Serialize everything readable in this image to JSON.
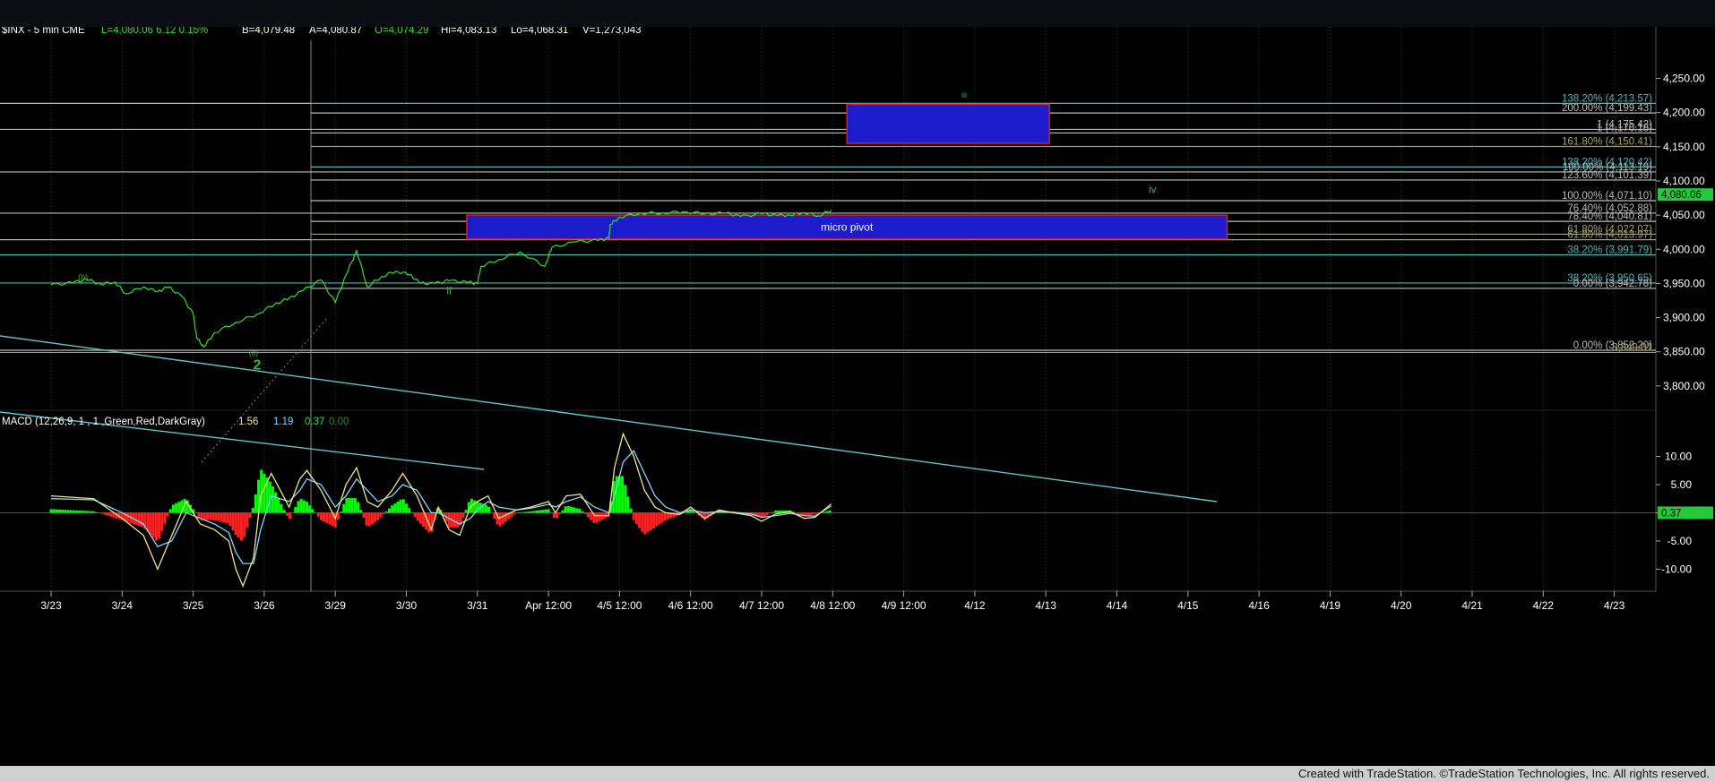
{
  "header": {
    "symbol_label": "$INX - 5 min  CME",
    "quote_last": "L=4,080.06  6.12   0.15%",
    "quote_bid": "B=4,079.48",
    "quote_ask": "A=4,080.87",
    "quote_open": "O=4,074.29",
    "quote_high": "Hi=4,083.13",
    "quote_low": "Lo=4,068.31",
    "quote_volume": "V=1,273,043"
  },
  "macd_header": {
    "label": "MACD (12,26,9, 1 , 1 ,Green,Red,DarkGray)",
    "v1": "1.56",
    "v2": "1.19",
    "v3": "0.37",
    "v4": "0.00"
  },
  "footer_text": "Created with TradeStation. ©TradeStation Technologies, Inc. All rights reserved.",
  "colors": {
    "price": "#33dd33",
    "macd_line": "#f0e68c",
    "signal_line": "#7fd8ff",
    "hist_pos": "#00ff00",
    "hist_neg": "#ff2020",
    "trendline": "#5fc6c8",
    "box_fill": "#1c1ccc",
    "box_border": "#cc1f33",
    "last_price_bg": "#22c93a"
  },
  "chart_data": [
    {
      "type": "line",
      "title": "$INX - 5 min",
      "y_axis_ticks": [
        "4,250.00",
        "4,200.00",
        "4,150.00",
        "4,100.00",
        "4,050.00",
        "4,000.00",
        "3,950.00",
        "3,900.00",
        "3,850.00",
        "3,800.00"
      ],
      "ylim": [
        3788,
        4273
      ],
      "x_ticks": [
        "3/23",
        "3/24",
        "3/25",
        "3/26",
        "3/29",
        "3/30",
        "3/31",
        "Apr 12:00",
        "4/5 12:00",
        "4/6 12:00",
        "4/7 12:00",
        "4/8 12:00",
        "4/9 12:00",
        "4/12",
        "4/13",
        "4/14",
        "4/15",
        "4/16",
        "4/19",
        "4/20",
        "4/21",
        "4/22",
        "4/23"
      ],
      "last_price_label": "4,080.06",
      "price_series": [
        [
          0.0,
          3948
        ],
        [
          0.3,
          3951
        ],
        [
          0.5,
          3956
        ],
        [
          0.7,
          3949
        ],
        [
          0.9,
          3952
        ],
        [
          1.05,
          3935
        ],
        [
          1.3,
          3945
        ],
        [
          1.5,
          3938
        ],
        [
          1.65,
          3945
        ],
        [
          1.85,
          3930
        ],
        [
          2.0,
          3905
        ],
        [
          2.05,
          3870
        ],
        [
          2.15,
          3857
        ],
        [
          2.3,
          3878
        ],
        [
          2.6,
          3893
        ],
        [
          2.9,
          3905
        ],
        [
          3.15,
          3920
        ],
        [
          3.35,
          3928
        ],
        [
          3.55,
          3940
        ],
        [
          3.8,
          3955
        ],
        [
          4.0,
          3922
        ],
        [
          4.15,
          3962
        ],
        [
          4.3,
          3998
        ],
        [
          4.45,
          3945
        ],
        [
          4.65,
          3960
        ],
        [
          4.85,
          3968
        ],
        [
          5.05,
          3963
        ],
        [
          5.2,
          3950
        ],
        [
          5.4,
          3950
        ],
        [
          5.6,
          3954
        ],
        [
          5.85,
          3952
        ],
        [
          6.0,
          3950
        ],
        [
          6.05,
          3975
        ],
        [
          6.3,
          3985
        ],
        [
          6.6,
          3996
        ],
        [
          6.95,
          3975
        ],
        [
          7.05,
          4003
        ],
        [
          7.4,
          4011
        ],
        [
          7.7,
          4013
        ],
        [
          7.85,
          4016
        ],
        [
          7.87,
          4036
        ],
        [
          8.0,
          4047
        ],
        [
          8.3,
          4053
        ],
        [
          8.6,
          4053
        ],
        [
          8.9,
          4055
        ],
        [
          9.2,
          4052
        ],
        [
          9.5,
          4053
        ],
        [
          9.7,
          4048
        ],
        [
          10.0,
          4052
        ],
        [
          10.2,
          4050
        ],
        [
          10.4,
          4050
        ],
        [
          10.6,
          4054
        ],
        [
          10.8,
          4049
        ],
        [
          10.98,
          4057
        ]
      ],
      "fib_lines": [
        {
          "label": "138.20% (4,213.57)",
          "y": 4213.57
        },
        {
          "label": "200.00% (4,199.43)",
          "y": 4199.43
        },
        {
          "label": "1 (4,175.42)",
          "y": 4175.42
        },
        {
          "label": "1 (4,170.18)",
          "y": 4170.18
        },
        {
          "label": "161.80% (4,150.41)",
          "y": 4150.41
        },
        {
          "label": "138.20% (4,120.42)",
          "y": 4120.42
        },
        {
          "label": "100.00% (4,113.19)",
          "y": 4113.19
        },
        {
          "label": "123.60% (4,101.39)",
          "y": 4101.39
        },
        {
          "label": "100.00% (4,071.10)",
          "y": 4071.1
        },
        {
          "label": "76.40% (4,052.88)",
          "y": 4052.88
        },
        {
          "label": "78.40% (4,040.81)",
          "y": 4040.81
        },
        {
          "label": "61.80% (4,022.07)",
          "y": 4022.07
        },
        {
          "label": "61.80% (4,013.97)",
          "y": 4013.97
        },
        {
          "label": "38.20% (3,991.79)",
          "y": 3991.79
        },
        {
          "label": "38.20% (3,950.65)",
          "y": 3950.65
        },
        {
          "label": "0.00% (3,942.78)",
          "y": 3942.78
        },
        {
          "label": "0.00% (3,852.20)",
          "y": 3852.2
        },
        {
          "label": "3,849.01",
          "y": 3849.01
        }
      ],
      "boxes": [
        {
          "label": "",
          "x0": 11.2,
          "x1": 14.05,
          "y0": 4155,
          "y1": 4212
        },
        {
          "label": "micro pivot",
          "x0": 5.85,
          "x1": 16.55,
          "y0": 4015,
          "y1": 4050
        }
      ],
      "wave_labels": [
        {
          "text": "(b)",
          "x": 0.45,
          "y": 3955
        },
        {
          "text": "(c)",
          "x": 2.85,
          "y": 3845
        },
        {
          "text": "2",
          "x": 2.9,
          "y": 3824
        },
        {
          "text": "ii",
          "x": 5.6,
          "y": 3934
        },
        {
          "text": "iii",
          "x": 12.85,
          "y": 4222
        },
        {
          "text": "iv",
          "x": 15.5,
          "y": 4082
        }
      ]
    },
    {
      "type": "line",
      "title": "MACD (12,26,9, 1 , 1 ,Green,Red,DarkGray)",
      "y_axis_ticks": [
        "10.00",
        "5.00",
        "",
        "-5.00",
        "-10.00"
      ],
      "ylim": [
        -12,
        15
      ],
      "last_value_label": "0.37",
      "macd_series": [
        [
          0,
          3
        ],
        [
          0.6,
          2.5
        ],
        [
          1.0,
          -1
        ],
        [
          1.3,
          -4
        ],
        [
          1.5,
          -10
        ],
        [
          1.7,
          -4
        ],
        [
          1.9,
          2
        ],
        [
          2.1,
          -2
        ],
        [
          2.3,
          -3
        ],
        [
          2.5,
          -5
        ],
        [
          2.6,
          -10
        ],
        [
          2.7,
          -13
        ],
        [
          2.85,
          -8
        ],
        [
          2.95,
          3
        ],
        [
          3.1,
          7
        ],
        [
          3.35,
          1
        ],
        [
          3.5,
          6
        ],
        [
          3.6,
          7.5
        ],
        [
          3.8,
          4
        ],
        [
          4.0,
          -1
        ],
        [
          4.15,
          5
        ],
        [
          4.3,
          8
        ],
        [
          4.45,
          2
        ],
        [
          4.6,
          1
        ],
        [
          4.8,
          4
        ],
        [
          4.95,
          7
        ],
        [
          5.15,
          3
        ],
        [
          5.35,
          -3
        ],
        [
          5.45,
          1
        ],
        [
          5.6,
          -3
        ],
        [
          5.75,
          -4
        ],
        [
          5.9,
          1
        ],
        [
          6.0,
          2
        ],
        [
          6.15,
          3
        ],
        [
          6.3,
          -1
        ],
        [
          6.55,
          0.5
        ],
        [
          6.75,
          1
        ],
        [
          7.0,
          2
        ],
        [
          7.1,
          0
        ],
        [
          7.25,
          3
        ],
        [
          7.45,
          3.3
        ],
        [
          7.65,
          -0.5
        ],
        [
          7.85,
          -0.5
        ],
        [
          7.93,
          8
        ],
        [
          8.05,
          14
        ],
        [
          8.2,
          10
        ],
        [
          8.35,
          4
        ],
        [
          8.5,
          1
        ],
        [
          8.65,
          0
        ],
        [
          8.85,
          -0.3
        ],
        [
          9.0,
          1
        ],
        [
          9.2,
          -1
        ],
        [
          9.4,
          0.5
        ],
        [
          9.6,
          0
        ],
        [
          9.85,
          -0.5
        ],
        [
          10.0,
          -1.5
        ],
        [
          10.2,
          -0.2
        ],
        [
          10.4,
          0.2
        ],
        [
          10.6,
          -1
        ],
        [
          10.75,
          -0.8
        ],
        [
          10.98,
          1.56
        ]
      ],
      "signal_series": [
        [
          0,
          2.5
        ],
        [
          0.6,
          2.3
        ],
        [
          1.0,
          0
        ],
        [
          1.3,
          -2
        ],
        [
          1.5,
          -6
        ],
        [
          1.7,
          -5
        ],
        [
          1.9,
          0
        ],
        [
          2.1,
          -1
        ],
        [
          2.3,
          -2
        ],
        [
          2.5,
          -3.5
        ],
        [
          2.6,
          -7
        ],
        [
          2.7,
          -9
        ],
        [
          2.85,
          -9
        ],
        [
          2.95,
          -3
        ],
        [
          3.1,
          3
        ],
        [
          3.35,
          2
        ],
        [
          3.5,
          4
        ],
        [
          3.6,
          6
        ],
        [
          3.8,
          5
        ],
        [
          4.0,
          1
        ],
        [
          4.15,
          3
        ],
        [
          4.3,
          6
        ],
        [
          4.45,
          4
        ],
        [
          4.6,
          2
        ],
        [
          4.8,
          3
        ],
        [
          4.95,
          5
        ],
        [
          5.15,
          4
        ],
        [
          5.35,
          0
        ],
        [
          5.45,
          0
        ],
        [
          5.6,
          -1
        ],
        [
          5.75,
          -2
        ],
        [
          5.9,
          -1
        ],
        [
          6.0,
          0.5
        ],
        [
          6.15,
          2
        ],
        [
          6.3,
          1
        ],
        [
          6.55,
          0.5
        ],
        [
          6.75,
          0.8
        ],
        [
          7.0,
          1.5
        ],
        [
          7.1,
          1
        ],
        [
          7.25,
          2
        ],
        [
          7.45,
          2.8
        ],
        [
          7.65,
          1
        ],
        [
          7.85,
          0
        ],
        [
          7.93,
          3
        ],
        [
          8.05,
          9
        ],
        [
          8.2,
          11
        ],
        [
          8.35,
          7
        ],
        [
          8.5,
          3
        ],
        [
          8.65,
          1
        ],
        [
          8.85,
          0
        ],
        [
          9.0,
          0.5
        ],
        [
          9.2,
          0
        ],
        [
          9.4,
          0.2
        ],
        [
          9.6,
          0.1
        ],
        [
          9.85,
          -0.2
        ],
        [
          10.0,
          -0.8
        ],
        [
          10.2,
          -0.5
        ],
        [
          10.4,
          -0.1
        ],
        [
          10.6,
          -0.5
        ],
        [
          10.75,
          -0.6
        ],
        [
          10.98,
          1.19
        ]
      ]
    }
  ]
}
